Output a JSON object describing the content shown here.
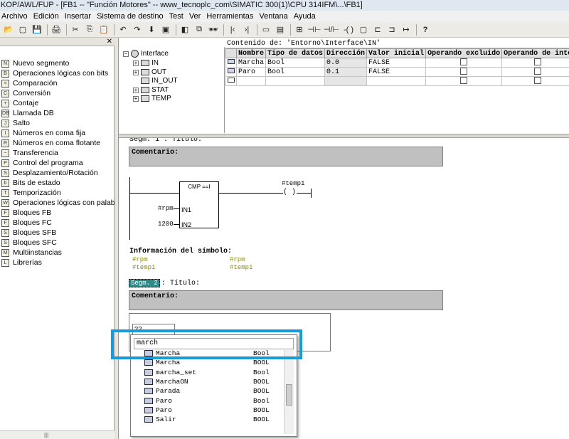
{
  "window": {
    "title": "KOP/AWL/FUP  - [FB1 -- \"Función Motores\" -- www_tecnoplc_com\\SIMATIC 300(1)\\CPU 314IFM\\...\\FB1]"
  },
  "menu": [
    "Archivo",
    "Edición",
    "Insertar",
    "Sistema de destino",
    "Test",
    "Ver",
    "Herramientas",
    "Ventana",
    "Ayuda"
  ],
  "toolbar": {
    "icons": [
      "open-icon",
      "new-icon",
      "save-icon",
      "print-icon",
      "cut-icon",
      "copy-icon",
      "paste-icon",
      "undo-icon",
      "redo-icon",
      "download-icon",
      "monitor-icon",
      "toggle-icon",
      "network-icon",
      "glasses-icon",
      "jump-left-icon",
      "jump-right-icon",
      "overview-icon",
      "detail-icon",
      "network-insert-icon",
      "contact-no-icon",
      "contact-nc-icon",
      "coil-icon",
      "box-icon",
      "branch-open-icon",
      "branch-close-icon",
      "connection-icon",
      "help-icon"
    ],
    "glyphs": [
      "📂",
      "▢",
      "💾",
      "🖨",
      "✂",
      "⎘",
      "📋",
      "↶",
      "↷",
      "⬇",
      "▣",
      "◧",
      "⧉",
      "🕶",
      "|‹",
      "›|",
      "▭",
      "▤",
      "⊞",
      "⊣⊢",
      "⊣/⊢",
      "-( )",
      "▢",
      "⊏",
      "⊐",
      "↦",
      "?"
    ]
  },
  "left_panel": {
    "items": [
      {
        "label": "Nuevo segmento",
        "icon": "new-network-icon",
        "glyph": "N"
      },
      {
        "label": "Operaciones lógicas con bits",
        "icon": "bit-logic-icon",
        "glyph": "B"
      },
      {
        "label": "Comparación",
        "icon": "comparison-icon",
        "glyph": "<"
      },
      {
        "label": "Conversión",
        "icon": "conversion-icon",
        "glyph": "C"
      },
      {
        "label": "Contaje",
        "icon": "counter-icon",
        "glyph": "+"
      },
      {
        "label": "Llamada DB",
        "icon": "db-call-icon",
        "glyph": "DB"
      },
      {
        "label": "Salto",
        "icon": "jump-icon",
        "glyph": "J"
      },
      {
        "label": "Números en coma fija",
        "icon": "integer-math-icon",
        "glyph": "I"
      },
      {
        "label": "Números en coma flotante",
        "icon": "float-math-icon",
        "glyph": "R"
      },
      {
        "label": "Transferencia",
        "icon": "move-icon",
        "glyph": "~"
      },
      {
        "label": "Control del programa",
        "icon": "program-control-icon",
        "glyph": "P"
      },
      {
        "label": "Desplazamiento/Rotación",
        "icon": "shift-rotate-icon",
        "glyph": "S"
      },
      {
        "label": "Bits de estado",
        "icon": "status-bits-icon",
        "glyph": "b"
      },
      {
        "label": "Temporización",
        "icon": "timer-icon",
        "glyph": "T"
      },
      {
        "label": "Operaciones lógicas con palabra",
        "icon": "word-logic-icon",
        "glyph": "W"
      },
      {
        "label": "Bloques FB",
        "icon": "fb-blocks-icon",
        "glyph": "F"
      },
      {
        "label": "Bloques FC",
        "icon": "fc-blocks-icon",
        "glyph": "F"
      },
      {
        "label": "Bloques SFB",
        "icon": "sfb-blocks-icon",
        "glyph": "S"
      },
      {
        "label": "Bloques SFC",
        "icon": "sfc-blocks-icon",
        "glyph": "S"
      },
      {
        "label": "Multiinstancias",
        "icon": "multiinstance-icon",
        "glyph": "M"
      },
      {
        "label": "Librerías",
        "icon": "libraries-icon",
        "glyph": "L"
      }
    ],
    "close_glyph": "✕",
    "scroll_glyph": "|||"
  },
  "tree": {
    "root": "Interface",
    "children": [
      "IN",
      "OUT",
      "IN_OUT",
      "STAT",
      "TEMP"
    ],
    "expand_glyph": "+",
    "collapse_glyph": "−"
  },
  "variables": {
    "caption": "Contenido de:  'Entorno\\Interface\\IN'",
    "columns": [
      "Nombre",
      "Tipo de datos",
      "Dirección",
      "Valor inicial",
      "Operando excluido",
      "Operando de inte"
    ],
    "rows": [
      {
        "name": "Marcha",
        "type": "Bool",
        "address": "0.0",
        "initial": "FALSE"
      },
      {
        "name": "Paro",
        "type": "Bool",
        "address": "0.1",
        "initial": "FALSE"
      }
    ]
  },
  "editor": {
    "seg1_header": "Segm. 1 : Título:",
    "comment_label": "Comentario:",
    "cmp_title": "CMP ==I",
    "in1_label": "IN1",
    "in2_label": "IN2",
    "in1_operand": "#rpm",
    "in2_operand": "1200",
    "coil_operand": "#temp1",
    "coil_glyph": "( )",
    "symbol_info_title": "Información del símbolo:",
    "symbol_info": {
      "col1": [
        "#rpm",
        "#temp1"
      ],
      "col2": [
        "#rpm",
        "#temp1"
      ]
    },
    "seg2_label": "Segm. 2",
    "seg2_title": ": Título:",
    "seg2_contact_label": "??"
  },
  "autocomplete": {
    "input_value": "march",
    "items": [
      {
        "name": "Marcha",
        "type": "Bool",
        "icon": "variable-icon"
      },
      {
        "name": "Marcha",
        "type": "BOOL",
        "icon": "variable-icon"
      },
      {
        "name": "marcha_set",
        "type": "Bool",
        "icon": "variable-icon"
      },
      {
        "name": "MarchaON",
        "type": "BOOL",
        "icon": "symbol-icon"
      },
      {
        "name": "Parada",
        "type": "BOOL",
        "icon": "symbol-icon"
      },
      {
        "name": "Paro",
        "type": "Bool",
        "icon": "variable-icon"
      },
      {
        "name": "Paro",
        "type": "BOOL",
        "icon": "symbol-icon"
      },
      {
        "name": "Salir",
        "type": "BOOL",
        "icon": "symbol-icon"
      }
    ],
    "scroll_up_glyph": "▲"
  },
  "colors": {
    "highlight": "#1a9bd7",
    "comment_bg": "#c0c0c0",
    "symbol_text": "#8a8a00",
    "seg_label_bg": "#2f8a8a"
  }
}
